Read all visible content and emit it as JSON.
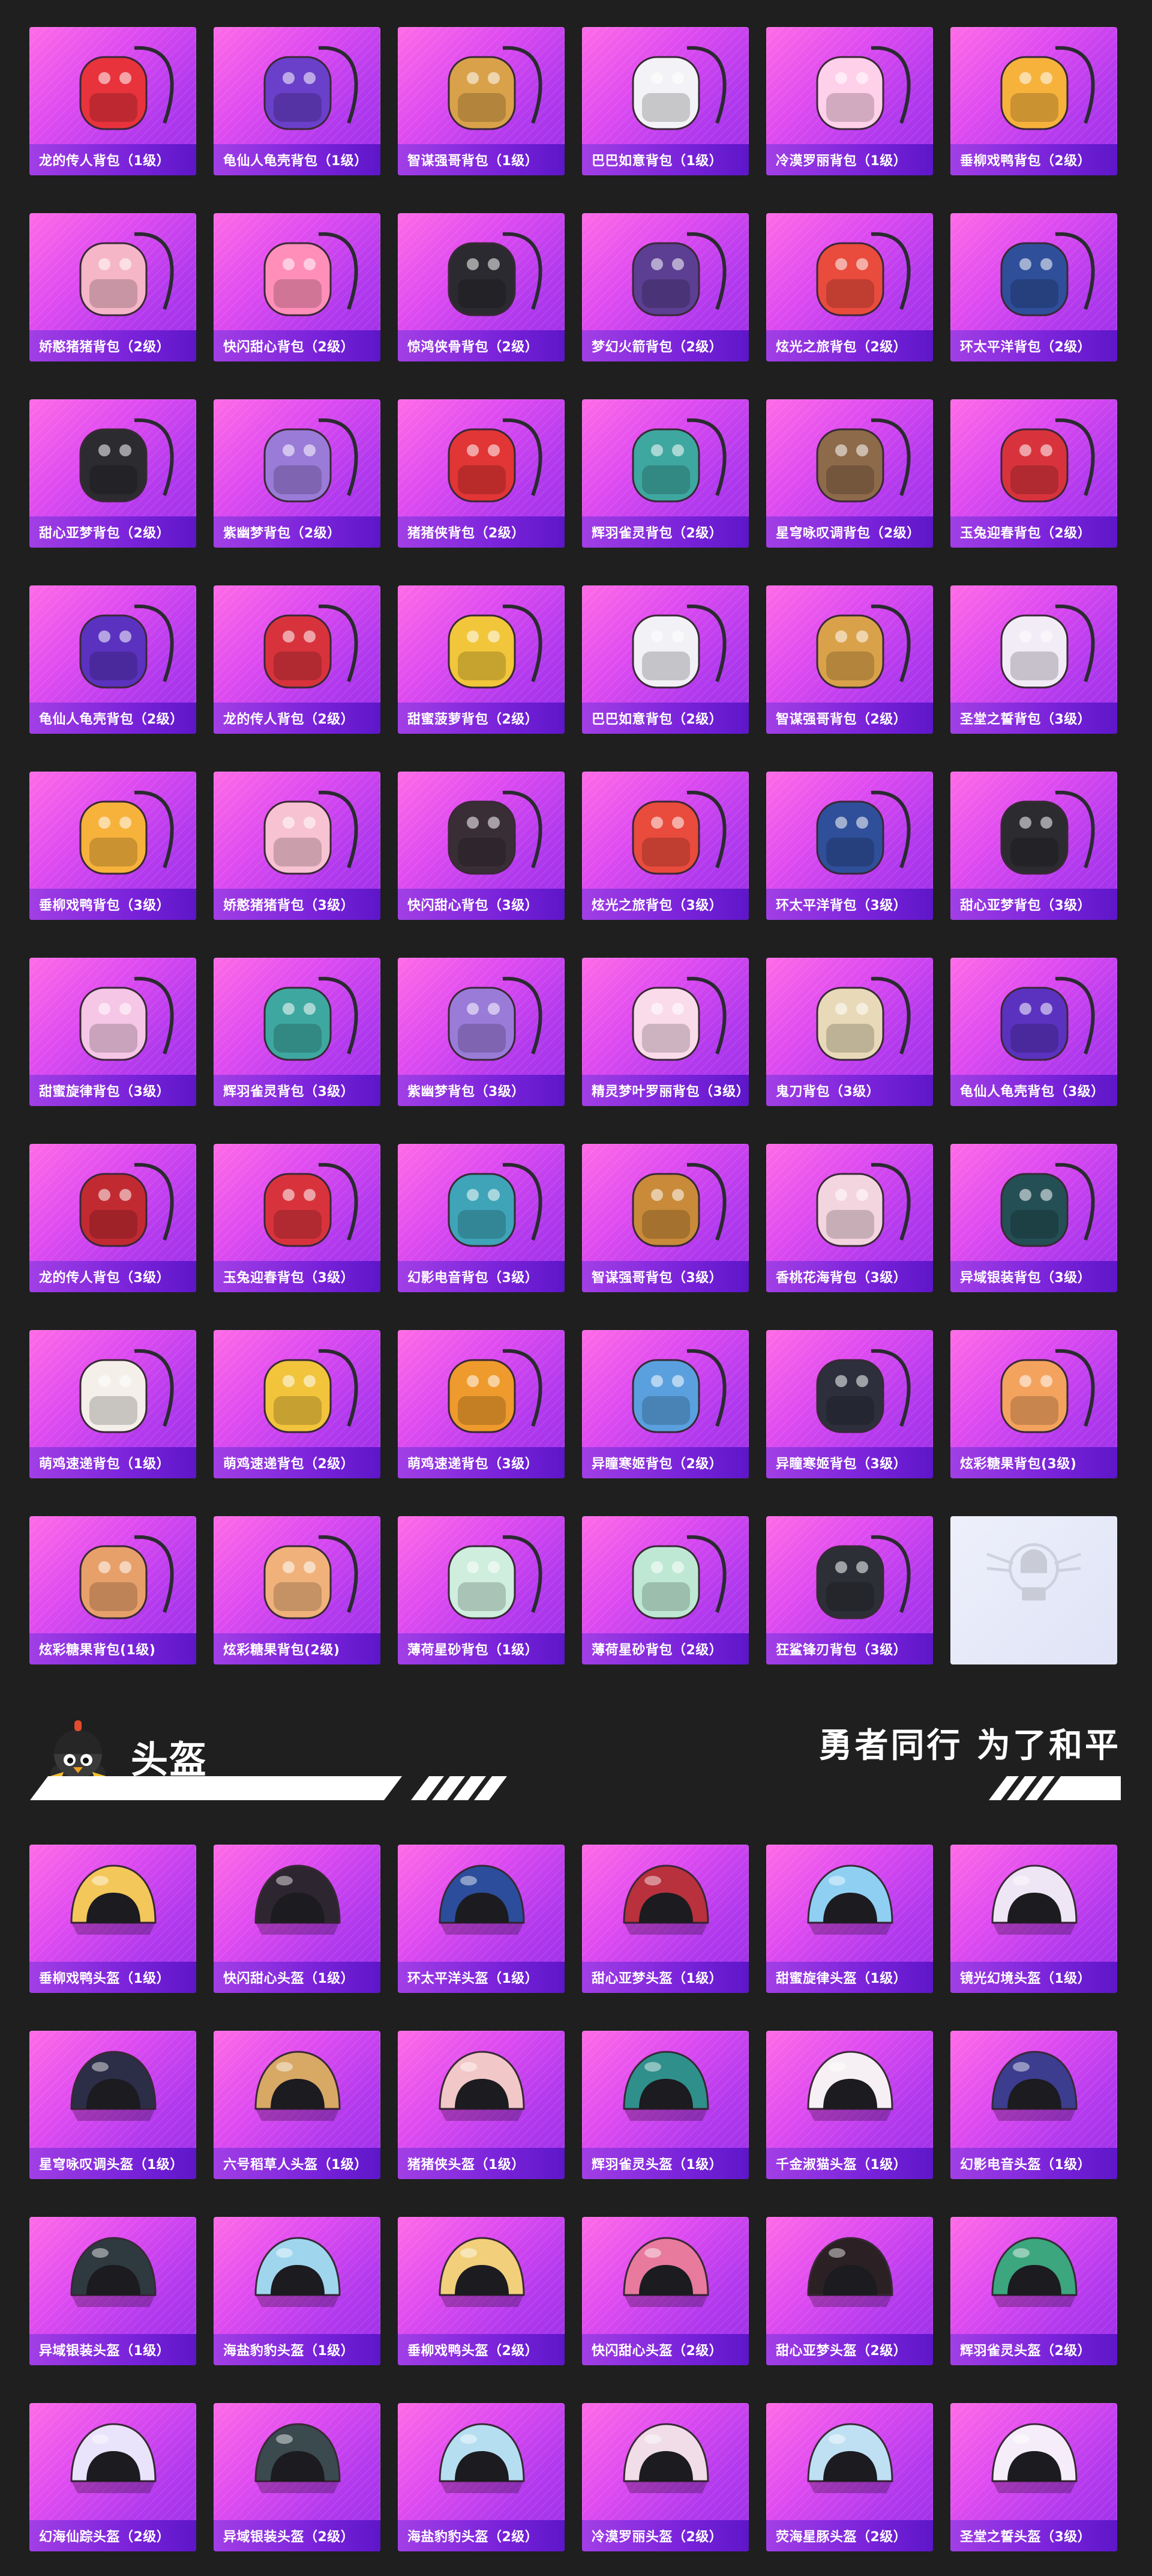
{
  "bags": [
    {
      "label": "龙的传人背包（1级）",
      "icon": "red-dragon-backpack-icon",
      "accent": "#e8333c"
    },
    {
      "label": "龟仙人龟壳背包（1级）",
      "icon": "turtle-shell-backpack-icon",
      "accent": "#6a3fc9"
    },
    {
      "label": "智谋强哥背包（1级）",
      "icon": "bear-face-backpack-icon",
      "accent": "#d9a24a"
    },
    {
      "label": "巴巴如意背包（1级）",
      "icon": "white-bunny-backpack-icon",
      "accent": "#f3f3f7"
    },
    {
      "label": "冷漠罗丽背包（1级）",
      "icon": "heart-pendant-backpack-icon",
      "accent": "#ffd0ea"
    },
    {
      "label": "垂柳戏鸭背包（2级）",
      "icon": "yellow-duck-backpack-icon",
      "accent": "#f7b23c"
    },
    {
      "label": "娇憨猪猪背包（2级）",
      "icon": "pink-pig-backpack-icon",
      "accent": "#f5b6c8"
    },
    {
      "label": "快闪甜心背包（2级）",
      "icon": "pink-bear-backpack-icon",
      "accent": "#ff8fb8"
    },
    {
      "label": "惊鸿侠骨背包（2级）",
      "icon": "black-armor-backpack-icon",
      "accent": "#2a2a30"
    },
    {
      "label": "梦幻火箭背包（2级）",
      "icon": "purple-rocket-backpack-icon",
      "accent": "#5c3f92"
    },
    {
      "label": "炫光之旅背包（2级）",
      "icon": "arcade-backpack-icon",
      "accent": "#e94b3c"
    },
    {
      "label": "环太平洋背包（2级）",
      "icon": "mech-backpack-icon",
      "accent": "#2f4f9a"
    },
    {
      "label": "甜心亚梦背包（2级）",
      "icon": "black-cat-backpack-icon",
      "accent": "#2b2b30"
    },
    {
      "label": "紫幽梦背包（2级）",
      "icon": "purple-bunny-backpack-icon",
      "accent": "#9a7bd8"
    },
    {
      "label": "猪猪侠背包（2级）",
      "icon": "red-pig-backpack-icon",
      "accent": "#e23535"
    },
    {
      "label": "辉羽雀灵背包（2级）",
      "icon": "feather-spirit-backpack-icon",
      "accent": "#3ea7a0"
    },
    {
      "label": "星穹咏叹调背包（2级）",
      "icon": "starry-bunny-backpack-icon",
      "accent": "#8d6a4a"
    },
    {
      "label": "玉兔迎春背包（2级）",
      "icon": "jade-rabbit-backpack-icon",
      "accent": "#d8333c"
    },
    {
      "label": "龟仙人龟壳背包（2级）",
      "icon": "turtle-shell-backpack-icon",
      "accent": "#5b32c0"
    },
    {
      "label": "龙的传人背包（2级）",
      "icon": "red-dragon-backpack-icon",
      "accent": "#d8333c"
    },
    {
      "label": "甜蜜菠萝背包（2级）",
      "icon": "pineapple-backpack-icon",
      "accent": "#f2c63a"
    },
    {
      "label": "巴巴如意背包（2级）",
      "icon": "white-bunny-backpack-icon",
      "accent": "#f1f1f6"
    },
    {
      "label": "智谋强哥背包（2级）",
      "icon": "bear-face-backpack-icon",
      "accent": "#d9a24a"
    },
    {
      "label": "圣堂之誓背包（3级）",
      "icon": "angel-wing-backpack-icon",
      "accent": "#f2ecf7"
    },
    {
      "label": "垂柳戏鸭背包（3级）",
      "icon": "yellow-duck-backpack-icon",
      "accent": "#f7b23c"
    },
    {
      "label": "娇憨猪猪背包（3级）",
      "icon": "pink-pig-backpack-icon",
      "accent": "#f7c2d1"
    },
    {
      "label": "快闪甜心背包（3级）",
      "icon": "black-bear-backpack-icon",
      "accent": "#3a2e36"
    },
    {
      "label": "炫光之旅背包（3级）",
      "icon": "arcade-backpack-icon",
      "accent": "#e94b3c"
    },
    {
      "label": "环太平洋背包（3级）",
      "icon": "mech-backpack-icon",
      "accent": "#2f4f9a"
    },
    {
      "label": "甜心亚梦背包（3级）",
      "icon": "black-cat-backpack-icon",
      "accent": "#2b2b30"
    },
    {
      "label": "甜蜜旋律背包（3级）",
      "icon": "cake-backpack-icon",
      "accent": "#f6c6e6"
    },
    {
      "label": "辉羽雀灵背包（3级）",
      "icon": "feather-spirit-backpack-icon",
      "accent": "#3ea7a0"
    },
    {
      "label": "紫幽梦背包（3级）",
      "icon": "purple-bunny-backpack-icon",
      "accent": "#9a7bd8"
    },
    {
      "label": "精灵梦叶罗丽背包（3级）",
      "icon": "heart-pendant-backpack-icon",
      "accent": "#f9dbe9"
    },
    {
      "label": "鬼刀背包（3级）",
      "icon": "golden-blade-backpack-icon",
      "accent": "#e8d9b8"
    },
    {
      "label": "龟仙人龟壳背包（3级）",
      "icon": "turtle-shell-backpack-icon",
      "accent": "#5b32c0"
    },
    {
      "label": "龙的传人背包（3级）",
      "icon": "red-dragon-backpack-icon",
      "accent": "#c22a32"
    },
    {
      "label": "玉兔迎春背包（3级）",
      "icon": "jade-rabbit-backpack-icon",
      "accent": "#d8333c"
    },
    {
      "label": "幻影电音背包（3级）",
      "icon": "speaker-backpack-icon",
      "accent": "#3fa4b8"
    },
    {
      "label": "智谋强哥背包（3级）",
      "icon": "bear-face-backpack-icon",
      "accent": "#c98a3a"
    },
    {
      "label": "香桃花海背包（3级）",
      "icon": "peach-blossom-backpack-icon",
      "accent": "#f3d5df"
    },
    {
      "label": "异域银装背包（3级）",
      "icon": "dark-teal-backpack-icon",
      "accent": "#244f55"
    },
    {
      "label": "萌鸡速递背包（1级）",
      "icon": "chick-backpack-icon",
      "accent": "#f4efe9"
    },
    {
      "label": "萌鸡速递背包（2级）",
      "icon": "chick-backpack-icon",
      "accent": "#f2c43c"
    },
    {
      "label": "萌鸡速递背包（3级）",
      "icon": "chick-backpack-icon",
      "accent": "#ef9a2c"
    },
    {
      "label": "异瞳寒姬背包（2级）",
      "icon": "blue-cat-backpack-icon",
      "accent": "#5aa0de"
    },
    {
      "label": "异瞳寒姬背包（3级）",
      "icon": "blue-cat-backpack-icon",
      "accent": "#2d2f3c"
    },
    {
      "label": "炫彩糖果背包(3级)",
      "icon": "donut-backpack-icon",
      "accent": "#f4a35e"
    },
    {
      "label": "炫彩糖果背包(1级)",
      "icon": "donut-backpack-icon",
      "accent": "#e8a06a"
    },
    {
      "label": "炫彩糖果背包(2级)",
      "icon": "donut-backpack-icon",
      "accent": "#f0b27a"
    },
    {
      "label": "薄荷星砂背包（1级）",
      "icon": "mint-backpack-icon",
      "accent": "#cfeede"
    },
    {
      "label": "薄荷星砂背包（2级）",
      "icon": "mint-backpack-icon",
      "accent": "#bfe8d4"
    },
    {
      "label": "狂鲨锋刃背包（3级）",
      "icon": "shark-blade-backpack-icon",
      "accent": "#2c2f36"
    },
    {
      "label": "",
      "icon": "pubg-emblem-icon",
      "accent": "#c9ccd6",
      "blank": true
    }
  ],
  "section": {
    "title": "头盔",
    "slogan": "勇者同行 为了和平"
  },
  "helmets": [
    {
      "label": "垂柳戏鸭头盔（1级）",
      "icon": "duck-helmet-icon",
      "accent": "#f4c75a"
    },
    {
      "label": "快闪甜心头盔（1级）",
      "icon": "black-pink-helmet-icon",
      "accent": "#2d2530"
    },
    {
      "label": "环太平洋头盔（1级）",
      "icon": "mech-helmet-icon",
      "accent": "#2b4d9b"
    },
    {
      "label": "甜心亚梦头盔（1级）",
      "icon": "red-stripe-helmet-icon",
      "accent": "#b8313c"
    },
    {
      "label": "甜蜜旋律头盔（1级）",
      "icon": "candy-helmet-icon",
      "accent": "#8fd0f2"
    },
    {
      "label": "镜光幻境头盔（1级）",
      "icon": "pearl-helmet-icon",
      "accent": "#eee6f5"
    },
    {
      "label": "星穹咏叹调头盔（1级）",
      "icon": "starry-helmet-icon",
      "accent": "#2c2d47"
    },
    {
      "label": "六号稻草人头盔（1级）",
      "icon": "straw-helmet-icon",
      "accent": "#d8a865"
    },
    {
      "label": "猪猪侠头盔（1级）",
      "icon": "pig-hero-helmet-icon",
      "accent": "#f2c7c7"
    },
    {
      "label": "辉羽雀灵头盔（1级）",
      "icon": "feather-helmet-icon",
      "accent": "#2f8f8b"
    },
    {
      "label": "千金淑猫头盔（1级）",
      "icon": "cat-helmet-icon",
      "accent": "#f6f0f4"
    },
    {
      "label": "幻影电音头盔（1级）",
      "icon": "neon-helmet-icon",
      "accent": "#3c3d8f"
    },
    {
      "label": "异域银装头盔（1级）",
      "icon": "teal-goggle-helmet-icon",
      "accent": "#2f3a40"
    },
    {
      "label": "海盐豹豹头盔（1级）",
      "icon": "blue-leopard-helmet-icon",
      "accent": "#9fd6ee"
    },
    {
      "label": "垂柳戏鸭头盔（2级）",
      "icon": "duck-helmet-icon",
      "accent": "#f2cf7a"
    },
    {
      "label": "快闪甜心头盔（2级）",
      "icon": "black-pink-helmet-icon",
      "accent": "#e87a9e"
    },
    {
      "label": "甜心亚梦头盔（2级）",
      "icon": "red-stripe-helmet-icon",
      "accent": "#2b2024"
    },
    {
      "label": "辉羽雀灵头盔（2级）",
      "icon": "feather-helmet-icon",
      "accent": "#3ca67e"
    },
    {
      "label": "幻海仙踪头盔（2级）",
      "icon": "fish-helmet-icon",
      "accent": "#e9e4fb"
    },
    {
      "label": "异域银装头盔（2级）",
      "icon": "teal-goggle-helmet-icon",
      "accent": "#3a4a4f"
    },
    {
      "label": "海盐豹豹头盔（2级）",
      "icon": "blue-leopard-helmet-icon",
      "accent": "#b6def1"
    },
    {
      "label": "冷漠罗丽头盔（2级）",
      "icon": "lace-helmet-icon",
      "accent": "#f0dde7"
    },
    {
      "label": "荧海星豚头盔（2级）",
      "icon": "dolphin-helmet-icon",
      "accent": "#bfe0f3"
    },
    {
      "label": "圣堂之誓头盔（3级）",
      "icon": "angel-helmet-icon",
      "accent": "#f5eefa"
    }
  ]
}
